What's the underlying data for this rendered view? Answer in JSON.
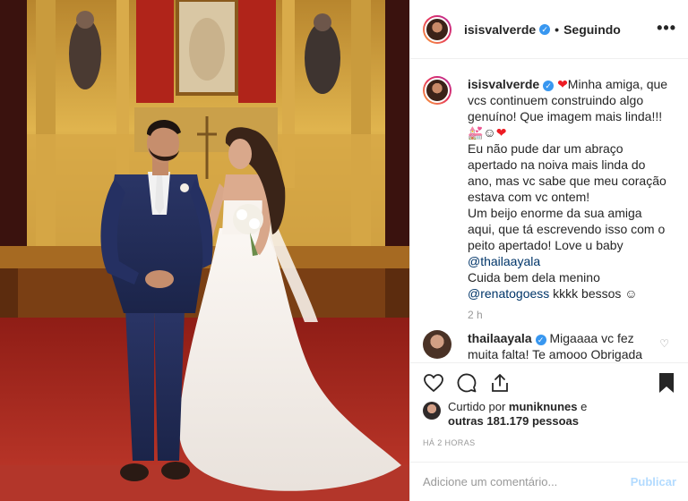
{
  "header": {
    "username": "isisvalverde",
    "separator": "•",
    "follow_status": "Seguindo",
    "more": "•••"
  },
  "caption": {
    "username": "isisvalverde",
    "heart": "❤",
    "text_1": "Minha amiga, que vcs continuem construindo algo genuíno! Que imagem mais linda!!! ",
    "emoji_line": "💒☺",
    "text_2": "Eu não pude dar um abraço apertado na noiva mais linda do ano, mas vc sabe que meu coração estava com vc ontem!",
    "text_3": "Um beijo enorme da sua amiga aqui, que tá escrevendo isso com o peito apertado! Love u baby ",
    "mention_1": "@thailaayala",
    "text_4": "Cuida bem dela menino",
    "mention_2": "@renatogoess",
    "text_5": " kkkk bessos ☺",
    "time": "2 h"
  },
  "reply": {
    "username": "thailaayala",
    "text": "Migaaaa vc fez muita falta! Te amooo Obrigada 🙏"
  },
  "likes": {
    "prefix": "Curtido por ",
    "user": "muniknunes",
    "connector": " e",
    "others": "outras 181.179 pessoas"
  },
  "time_ago": "HÁ 2 HORAS",
  "comment_box": {
    "placeholder": "Adicione um comentário...",
    "publish": "Publicar"
  },
  "colors": {
    "verified": "#3897f0",
    "mention": "#003569",
    "publish_disabled": "#b3dbff"
  },
  "icons": [
    "heart-icon",
    "comment-icon",
    "share-icon",
    "bookmark-icon",
    "more-icon",
    "verified-icon"
  ]
}
